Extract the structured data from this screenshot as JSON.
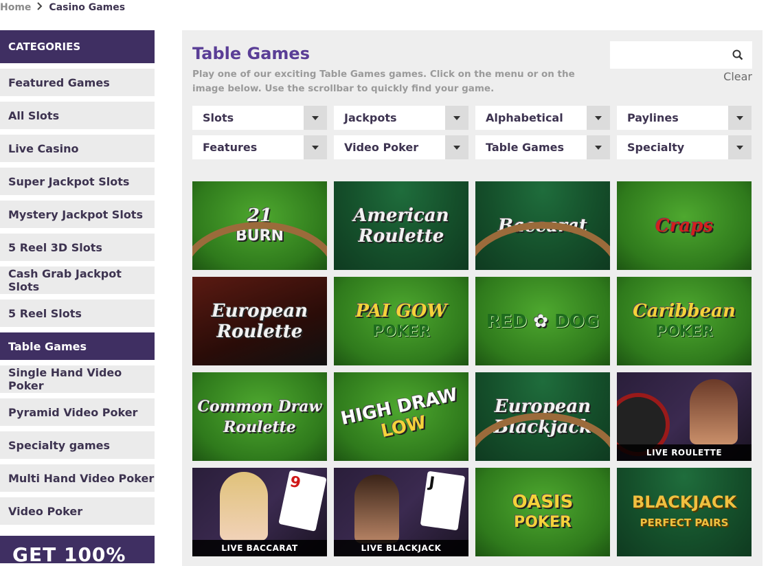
{
  "breadcrumb": {
    "home": "Home",
    "current": "Casino Games"
  },
  "sidebar": {
    "header": "CATEGORIES",
    "items": [
      {
        "label": "Featured Games"
      },
      {
        "label": "All Slots"
      },
      {
        "label": "Live Casino"
      },
      {
        "label": "Super Jackpot Slots"
      },
      {
        "label": "Mystery Jackpot Slots"
      },
      {
        "label": "5 Reel 3D Slots"
      },
      {
        "label": "Cash Grab Jackpot Slots"
      },
      {
        "label": "5 Reel Slots"
      },
      {
        "label": "Table Games",
        "active": true
      },
      {
        "label": "Single Hand Video Poker"
      },
      {
        "label": "Pyramid Video Poker"
      },
      {
        "label": "Specialty games"
      },
      {
        "label": "Multi Hand Video Poker"
      },
      {
        "label": "Video Poker"
      }
    ],
    "promo": "GET 100%"
  },
  "main": {
    "title": "Table Games",
    "description": "Play one of our exciting Table Games games. Click on the menu or on the image below. Use the scrollbar to quickly find your game.",
    "search": {
      "value": "",
      "placeholder": ""
    },
    "clear_label": "Clear",
    "filters": [
      {
        "label": "Slots"
      },
      {
        "label": "Jackpots"
      },
      {
        "label": "Alphabetical"
      },
      {
        "label": "Paylines"
      },
      {
        "label": "Features"
      },
      {
        "label": "Video Poker"
      },
      {
        "label": "Table Games"
      },
      {
        "label": "Specialty"
      }
    ],
    "games": [
      {
        "line1": "21",
        "line2": "BURN"
      },
      {
        "line1": "American",
        "line2": "Roulette"
      },
      {
        "line1": "Baccarat",
        "line2": ""
      },
      {
        "line1": "Craps",
        "line2": ""
      },
      {
        "line1": "European",
        "line2": "Roulette"
      },
      {
        "line1": "PAI GOW",
        "line2": "POKER"
      },
      {
        "line1": "RED",
        "line2": "DOG"
      },
      {
        "line1": "Caribbean",
        "line2": "POKER"
      },
      {
        "line1": "Common Draw",
        "line2": "Roulette"
      },
      {
        "line1": "HIGH DRAW",
        "line2": "LOW"
      },
      {
        "line1": "European",
        "line2": "Blackjack"
      },
      {
        "live": "LIVE ROULETTE"
      },
      {
        "live": "LIVE BACCARAT"
      },
      {
        "live": "LIVE BLACKJACK"
      },
      {
        "line1": "OASIS",
        "line2": "POKER"
      },
      {
        "line1": "BLACKJACK",
        "line2": "PERFECT PAIRS"
      }
    ]
  },
  "colors": {
    "brand": "#3f2f62",
    "title": "#5a3e96",
    "panel": "#eeeeee",
    "item_bg": "#ebebeb"
  },
  "icons": {
    "search": "search-icon",
    "breadcrumb_sep": "chevron-right-icon",
    "dropdown": "caret-down-icon"
  }
}
